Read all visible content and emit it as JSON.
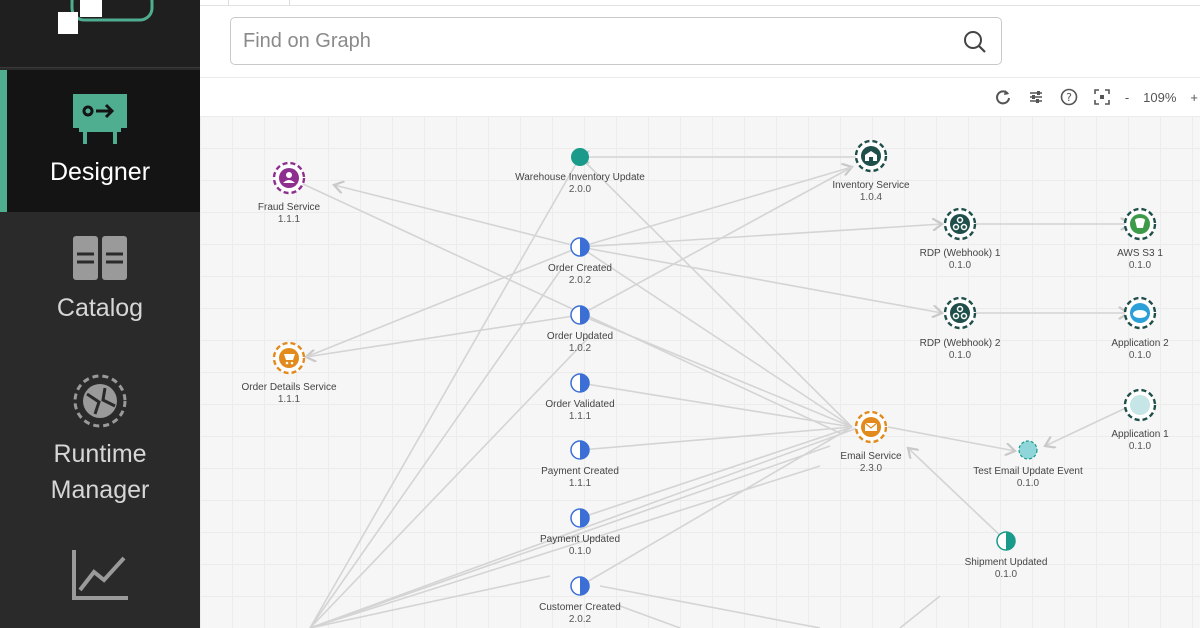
{
  "sidebar": {
    "items": [
      {
        "label": "Designer",
        "active": true
      },
      {
        "label": "Catalog",
        "active": false
      },
      {
        "label": "Runtime Manager",
        "active": false
      }
    ]
  },
  "search": {
    "placeholder": "Find on Graph"
  },
  "toolbar": {
    "zoom_minus": "-",
    "zoom": "109%",
    "zoom_plus": "+"
  },
  "colors": {
    "accent": "#4fae90",
    "teal": "#1a9a8a",
    "blue": "#3b6fd6",
    "purple": "#8e2f8f",
    "orange": "#e38a1c",
    "green": "#3c9a48",
    "lightblue": "#2a9fd8"
  },
  "graph": {
    "nodes": [
      {
        "name": "fraud-service",
        "title": "Fraud Service",
        "version": "1.1.1",
        "icon": "user-icon",
        "color": "#8e2f8f"
      },
      {
        "name": "order-details-service",
        "title": "Order Details Service",
        "version": "1.1.1",
        "icon": "cart-icon",
        "color": "#e38a1c"
      },
      {
        "name": "warehouse-inventory-update",
        "title": "Warehouse Inventory Update",
        "version": "2.0.0",
        "icon": "event-icon",
        "color": "#1a9a8a"
      },
      {
        "name": "inventory-service",
        "title": "Inventory Service",
        "version": "1.0.4",
        "icon": "warehouse-icon",
        "color": "#1f4f4a"
      },
      {
        "name": "order-created",
        "title": "Order Created",
        "version": "2.0.2",
        "icon": "half-circle-icon",
        "color": "#3b6fd6"
      },
      {
        "name": "order-updated",
        "title": "Order Updated",
        "version": "1.0.2",
        "icon": "half-circle-icon",
        "color": "#3b6fd6"
      },
      {
        "name": "order-validated",
        "title": "Order Validated",
        "version": "1.1.1",
        "icon": "half-circle-icon",
        "color": "#3b6fd6"
      },
      {
        "name": "payment-created",
        "title": "Payment Created",
        "version": "1.1.1",
        "icon": "half-circle-icon",
        "color": "#3b6fd6"
      },
      {
        "name": "payment-updated",
        "title": "Payment Updated",
        "version": "0.1.0",
        "icon": "half-circle-icon",
        "color": "#3b6fd6"
      },
      {
        "name": "customer-created",
        "title": "Customer Created",
        "version": "2.0.2",
        "icon": "half-circle-icon",
        "color": "#3b6fd6"
      },
      {
        "name": "rdp-webhook-1",
        "title": "RDP (Webhook) 1",
        "version": "0.1.0",
        "icon": "webhook-icon",
        "color": "#1f4f4a"
      },
      {
        "name": "rdp-webhook-2",
        "title": "RDP (Webhook) 2",
        "version": "0.1.0",
        "icon": "webhook-icon",
        "color": "#1f4f4a"
      },
      {
        "name": "aws-s3-1",
        "title": "AWS S3 1",
        "version": "0.1.0",
        "icon": "s3-icon",
        "color": "#3c9a48"
      },
      {
        "name": "application-2",
        "title": "Application 2",
        "version": "0.1.0",
        "icon": "salesforce-icon",
        "color": "#2a9fd8"
      },
      {
        "name": "application-1",
        "title": "Application 1",
        "version": "0.1.0",
        "icon": "application-icon",
        "color": "#b9dfe0"
      },
      {
        "name": "email-service",
        "title": "Email Service",
        "version": "2.3.0",
        "icon": "envelope-icon",
        "color": "#e38a1c"
      },
      {
        "name": "test-email-update-event",
        "title": "Test Email Update Event",
        "version": "0.1.0",
        "icon": "event-icon",
        "color": "#8fd6da"
      },
      {
        "name": "shipment-updated",
        "title": "Shipment Updated",
        "version": "0.1.0",
        "icon": "half-circle-icon",
        "color": "#1a9a8a"
      }
    ]
  }
}
